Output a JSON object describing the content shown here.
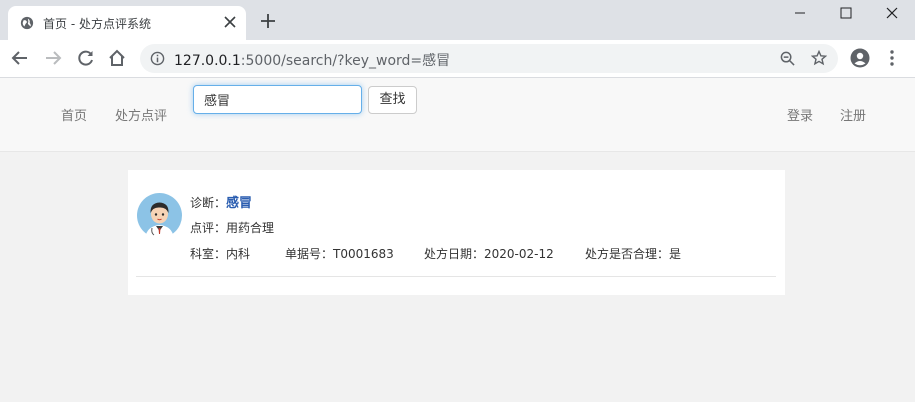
{
  "browser": {
    "tab_title": "首页 - 处方点评系统",
    "url_host": "127.0.0.1",
    "url_rest": ":5000/search/?key_word=感冒"
  },
  "navbar": {
    "home": "首页",
    "review": "处方点评",
    "search_value": "感冒",
    "search_button": "查找",
    "login": "登录",
    "register": "注册"
  },
  "result": {
    "diagnosis_label": "诊断：",
    "diagnosis_value": "感冒",
    "review_label": "点评：",
    "review_value": "用药合理",
    "department_label": "科室：",
    "department_value": "内科",
    "order_label": "单据号：",
    "order_value": "T0001683",
    "date_label": "处方日期：",
    "date_value": "2020-02-12",
    "reasonable_label": "处方是否合理：",
    "reasonable_value": "是"
  },
  "colors": {
    "focus_border": "#66afe9",
    "diagnosis_link": "#2a5db0",
    "avatar_bg": "#8cc3e6"
  }
}
